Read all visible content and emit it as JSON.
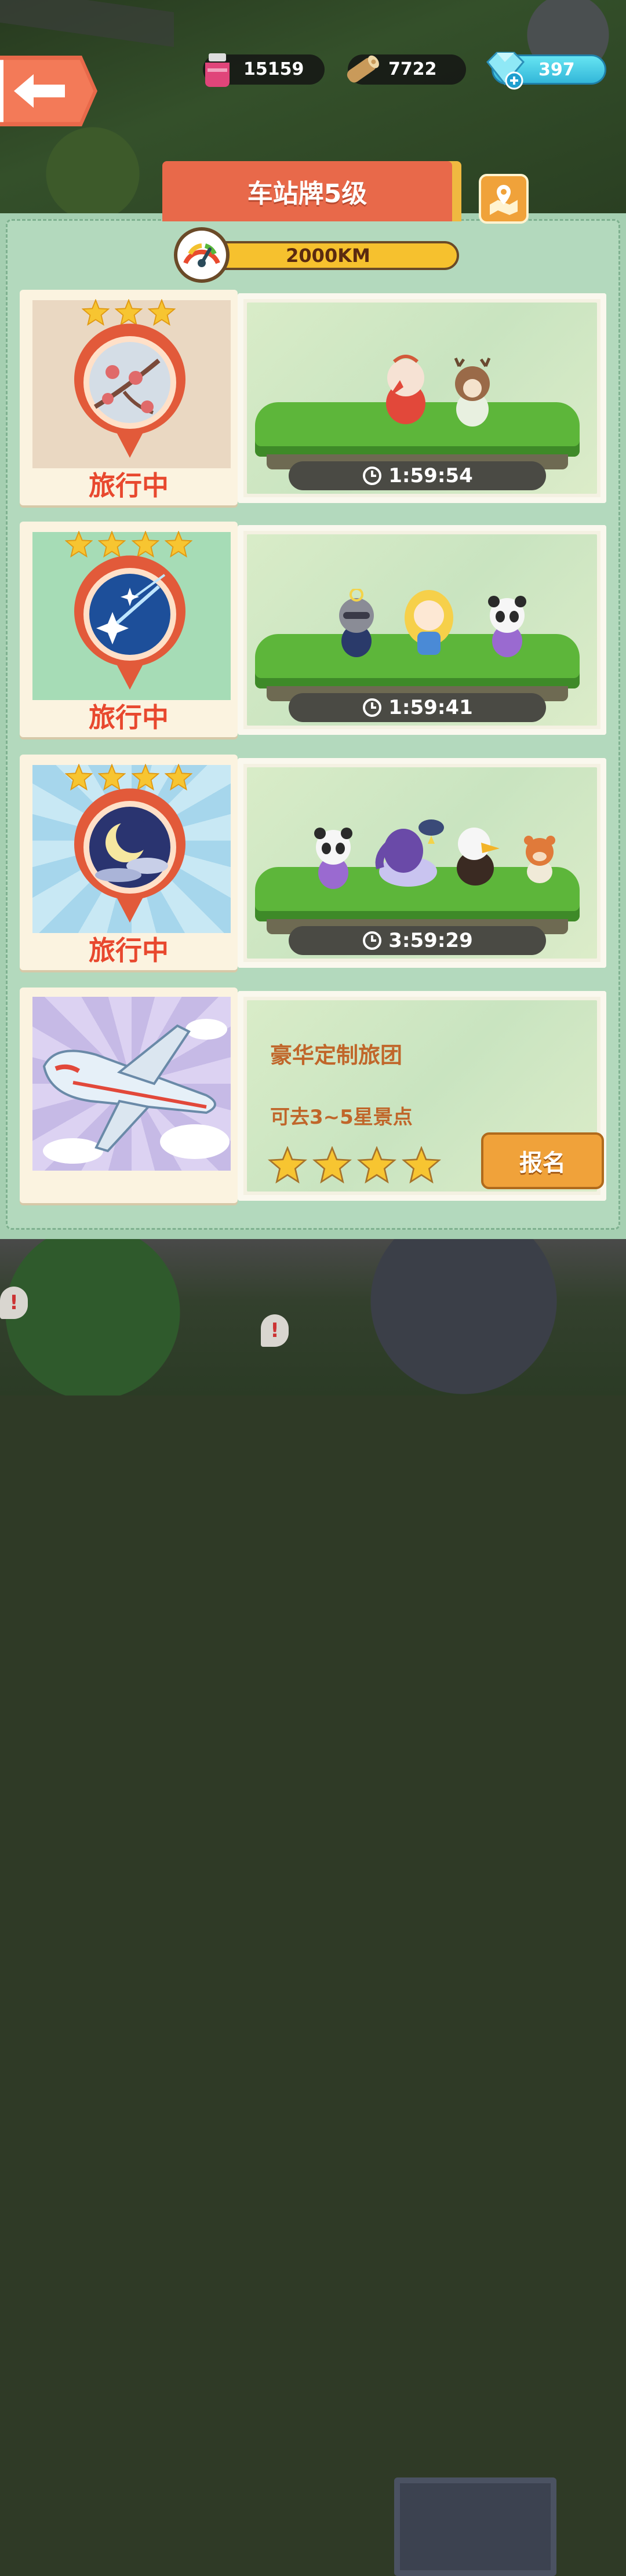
{
  "resources": {
    "potion_icon": "potion-icon",
    "potion_count": "15159",
    "wood_icon": "wood-icon",
    "wood_count": "7722",
    "gem_icon": "gem-icon",
    "gem_count": "397"
  },
  "panel": {
    "title": "车站牌5级",
    "distance": "2000KM"
  },
  "trips": [
    {
      "status": "旅行中",
      "timer": "1:59:54",
      "stars": 3,
      "theme": "plum-blossom",
      "accent": "#e25a3a"
    },
    {
      "status": "旅行中",
      "timer": "1:59:41",
      "stars": 4,
      "theme": "shooting-star",
      "accent": "#e25a3a"
    },
    {
      "status": "旅行中",
      "timer": "3:59:29",
      "stars": 4,
      "theme": "moon-night",
      "accent": "#e25a3a"
    }
  ],
  "custom_tour": {
    "title": "豪华定制旅团",
    "subtitle": "可去3~5星景点",
    "stars": 4,
    "signup_label": "报名"
  },
  "colors": {
    "panel_bg": "#a5cfb1",
    "title_tab": "#e8694a",
    "status_text": "#e8482e",
    "button_orange": "#f0a23a"
  }
}
